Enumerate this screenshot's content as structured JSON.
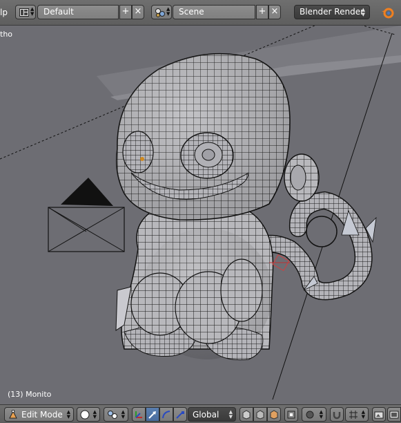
{
  "header": {
    "menu_fragment": "lp",
    "screen_layout": "Default",
    "scene": "Scene",
    "render_engine": "Blender Render"
  },
  "viewport": {
    "view_label": "tho",
    "object_label": "(13) Monito"
  },
  "footer": {
    "mode": "Edit Mode",
    "orientation": "Global"
  },
  "colors": {
    "header_bg": "#656565",
    "viewport_bg": "#6d6d73",
    "mesh_fill": "#b9b9bd",
    "wire": "#111111",
    "active_blue": "#5a7fb0"
  }
}
